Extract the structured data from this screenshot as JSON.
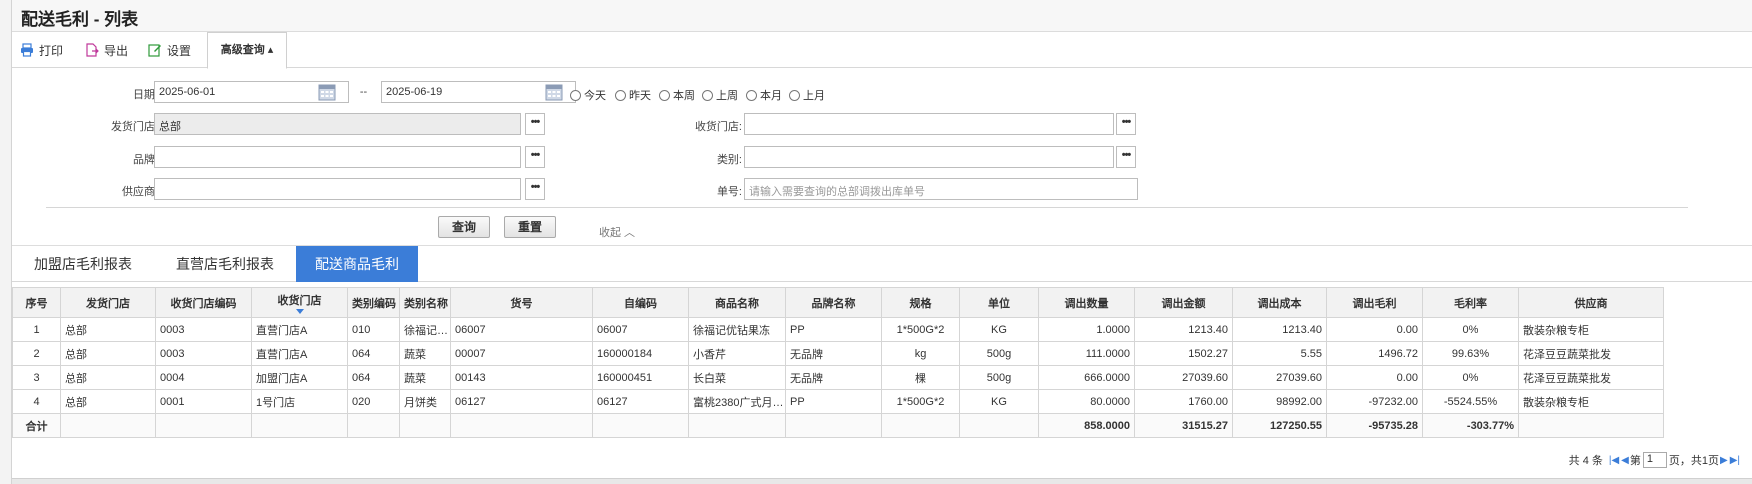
{
  "title": "配送毛利 - 列表",
  "toolbar": {
    "print": "打印",
    "export": "导出",
    "settings": "设置",
    "advanced": "高级查询 ▴"
  },
  "form": {
    "date_label": "日期:",
    "date_from": "2025-06-01",
    "date_sep": "--",
    "date_to": "2025-06-19",
    "quick_dates": [
      "今天",
      "昨天",
      "本周",
      "上周",
      "本月",
      "上月"
    ],
    "send_store_label": "发货门店:",
    "send_store_value": "总部",
    "recv_store_label": "收货门店:",
    "brand_label": "品牌:",
    "category_label": "类别:",
    "supplier_label": "供应商:",
    "order_no_label": "单号:",
    "order_no_placeholder": "请输入需要查询的总部调拨出库单号",
    "query": "查询",
    "reset": "重置",
    "collapse": "收起 ︿"
  },
  "tabs": [
    "加盟店毛利报表",
    "直营店毛利报表",
    "配送商品毛利"
  ],
  "table": {
    "headers": [
      "序号",
      "发货门店",
      "收货门店编码",
      "收货门店",
      "类别编码",
      "类别名称",
      "货号",
      "自编码",
      "商品名称",
      "品牌名称",
      "规格",
      "单位",
      "调出数量",
      "调出金额",
      "调出成本",
      "调出毛利",
      "毛利率",
      "供应商"
    ],
    "rows": [
      [
        "1",
        "总部",
        "0003",
        "直营门店A",
        "010",
        "徐福记…",
        "06007",
        "06007",
        "徐福记优钻果冻",
        "PP",
        "1*500G*2",
        "KG",
        "1.0000",
        "1213.40",
        "1213.40",
        "0.00",
        "0%",
        "散装杂粮专柜"
      ],
      [
        "2",
        "总部",
        "0003",
        "直营门店A",
        "064",
        "蔬菜",
        "00007",
        "160000184",
        "小香芹",
        "无品牌",
        "kg",
        "500g",
        "111.0000",
        "1502.27",
        "5.55",
        "1496.72",
        "99.63%",
        "花泽豆豆蔬菜批发"
      ],
      [
        "3",
        "总部",
        "0004",
        "加盟门店A",
        "064",
        "蔬菜",
        "00143",
        "160000451",
        "长白菜",
        "无品牌",
        "棵",
        "500g",
        "666.0000",
        "27039.60",
        "27039.60",
        "0.00",
        "0%",
        "花泽豆豆蔬菜批发"
      ],
      [
        "4",
        "总部",
        "0001",
        "1号门店",
        "020",
        "月饼类",
        "06127",
        "06127",
        "富桃2380广式月…",
        "PP",
        "1*500G*2",
        "KG",
        "80.0000",
        "1760.00",
        "98992.00",
        "-97232.00",
        "-5524.55%",
        "散装杂粮专柜"
      ]
    ],
    "total": [
      "合计",
      "",
      "",
      "",
      "",
      "",
      "",
      "",
      "",
      "",
      "",
      "",
      "858.0000",
      "31515.27",
      "127250.55",
      "-95735.28",
      "-303.77%",
      ""
    ]
  },
  "pager": {
    "total_text": "共 4 条",
    "page_prefix": "第",
    "page": "1",
    "page_suffix": "页，共1页"
  },
  "colors": {
    "accent": "#3b7dd8"
  }
}
